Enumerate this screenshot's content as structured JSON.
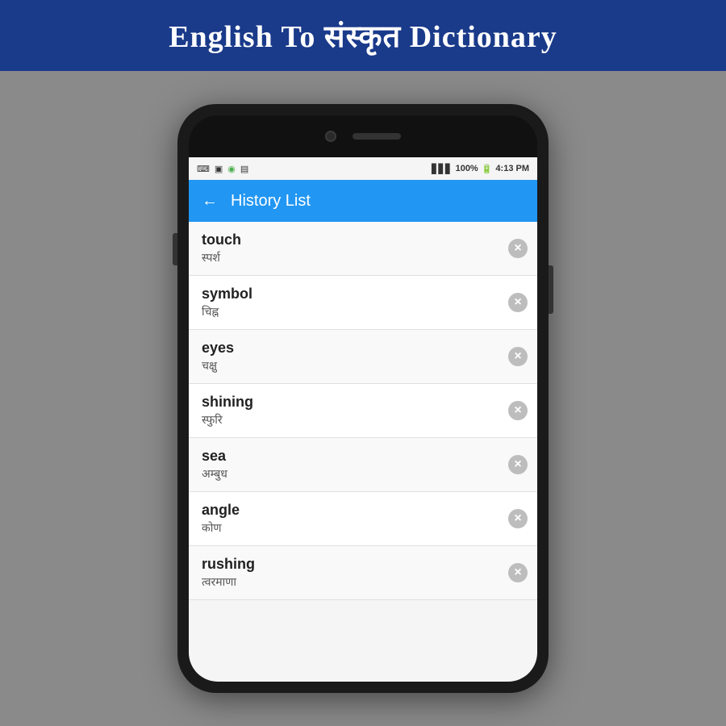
{
  "banner": {
    "title": "English To संस्कृत Dictionary"
  },
  "status_bar": {
    "time": "4:13 PM",
    "battery": "100%",
    "icons": [
      "⌨",
      "▣",
      "◉",
      "▤"
    ]
  },
  "app_bar": {
    "title": "History List",
    "back_label": "←"
  },
  "history_items": [
    {
      "english": "touch",
      "sanskrit": "स्पर्श"
    },
    {
      "english": "symbol",
      "sanskrit": "चिह्न"
    },
    {
      "english": "eyes",
      "sanskrit": "चक्षु"
    },
    {
      "english": "shining",
      "sanskrit": "स्फुरि"
    },
    {
      "english": "sea",
      "sanskrit": "अम्बुध"
    },
    {
      "english": "angle",
      "sanskrit": "कोण"
    },
    {
      "english": "rushing",
      "sanskrit": "त्वरमाणा"
    }
  ]
}
